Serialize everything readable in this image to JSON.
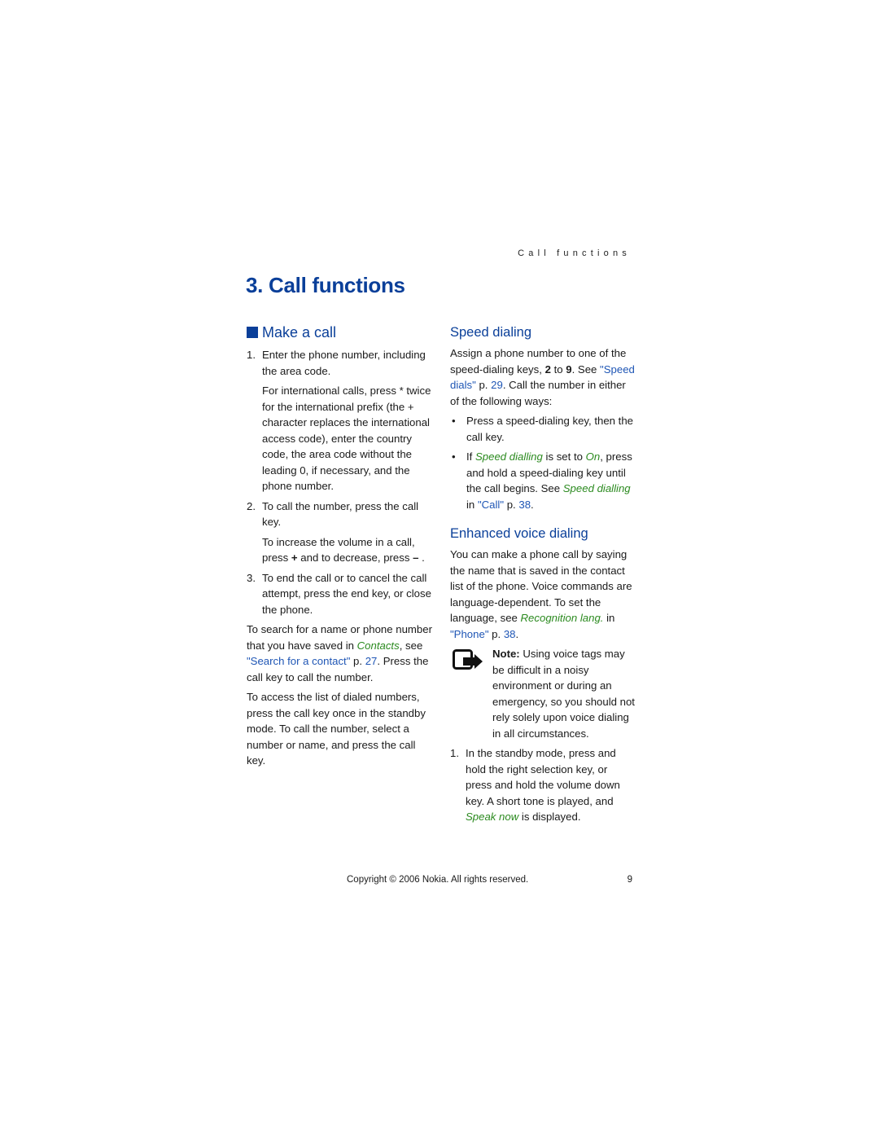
{
  "running_header": "Call functions",
  "chapter_title": "3. Call functions",
  "left": {
    "section_title": "Make a call",
    "steps": [
      {
        "num": "1.",
        "text": "Enter the phone number, including the area code.",
        "extra": "For international calls, press * twice for the international prefix (the + character replaces the international access code), enter the country code, the area code without the leading 0, if necessary, and the phone number."
      },
      {
        "num": "2.",
        "text": "To call the number, press the call key.",
        "extra_a": "To increase the volume in a call, press ",
        "extra_plus": "+",
        "extra_b": " and to decrease, press ",
        "extra_minus": "–",
        "extra_c": " ."
      },
      {
        "num": "3.",
        "text": "To end the call or to cancel the call attempt, press the end key, or close the phone."
      }
    ],
    "search_para": {
      "a": "To search for a name or phone number that you have saved in ",
      "contacts": "Contacts",
      "b": ", see ",
      "link": "\"Search for a contact\"",
      "c": " p. ",
      "page": "27",
      "d": ". Press the call key to call the number."
    },
    "dialed_para": "To access the list of dialed numbers, press the call key once in the standby mode. To call the number, select a number or name, and press the call key."
  },
  "right": {
    "speed": {
      "title": "Speed dialing",
      "intro_a": "Assign a phone number to one of the speed-dialing keys, ",
      "key_from": "2",
      "intro_b": " to ",
      "key_to": "9",
      "intro_c": ". See ",
      "link": "\"Speed dials\"",
      "intro_d": " p. ",
      "page": "29",
      "intro_e": ". Call the number in either of the following ways:",
      "bullets": {
        "b1": "Press a speed-dialing key, then the call key.",
        "b2_a": "If ",
        "b2_setting": "Speed dialling",
        "b2_b": " is set to ",
        "b2_on": "On",
        "b2_c": ", press and hold a speed-dialing key until the call begins. See ",
        "b2_setting2": "Speed dialling",
        "b2_d": " in ",
        "b2_link": "\"Call\"",
        "b2_e": " p. ",
        "b2_page": "38",
        "b2_f": "."
      }
    },
    "voice": {
      "title": "Enhanced voice dialing",
      "intro_a": "You can make a phone call by saying the name that is saved in the contact list of the phone. Voice commands are language-dependent. To set the language, see ",
      "setting": "Recognition lang.",
      "intro_b": " in ",
      "link": "\"Phone\"",
      "intro_c": " p. ",
      "page": "38",
      "intro_d": ".",
      "note_label": "Note:",
      "note_text": " Using voice tags may be difficult in a noisy environment or during an emergency, so you should not rely solely upon voice dialing in all circumstances.",
      "step1_num": "1.",
      "step1_a": "In the standby mode, press and hold the right selection key, or press and hold the volume down key. A short tone is played, and ",
      "step1_speak": "Speak now",
      "step1_b": " is displayed."
    }
  },
  "footer": {
    "copyright": "Copyright © 2006 Nokia. All rights reserved.",
    "page_number": "9"
  },
  "colors": {
    "heading_blue": "#0a3f99",
    "link_blue": "#1f56b5",
    "italic_green": "#2b8a1f"
  },
  "icons": {
    "section_marker": "square-bullet-icon",
    "note": "note-icon"
  }
}
